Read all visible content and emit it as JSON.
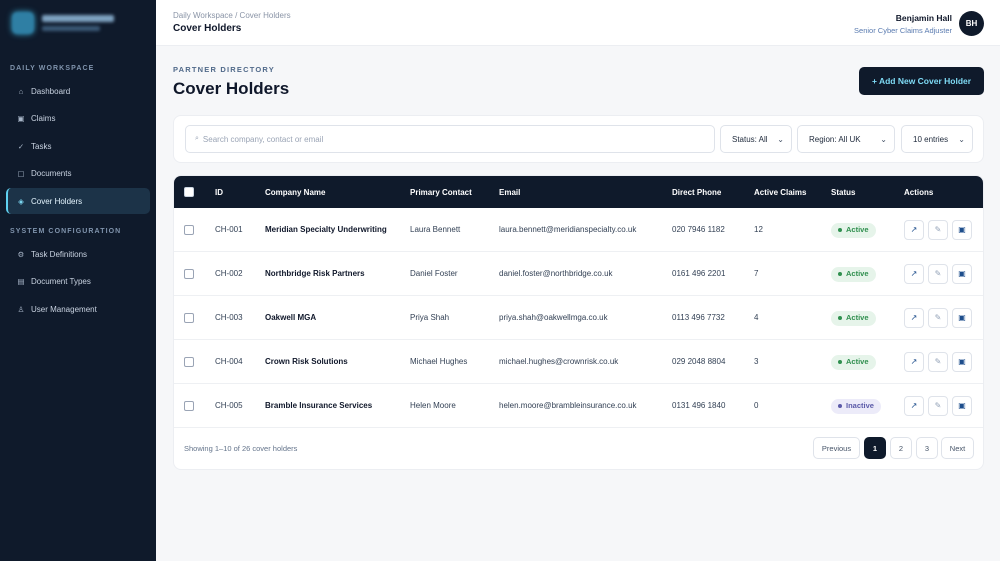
{
  "sidebar": {
    "sections": [
      {
        "title": "DAILY WORKSPACE",
        "items": [
          {
            "label": "Dashboard",
            "icon": "home-icon",
            "glyph": "⌂"
          },
          {
            "label": "Claims",
            "icon": "claims-icon",
            "glyph": "▣"
          },
          {
            "label": "Tasks",
            "icon": "check-icon",
            "glyph": "✓"
          },
          {
            "label": "Documents",
            "icon": "document-icon",
            "glyph": "▢"
          },
          {
            "label": "Cover Holders",
            "icon": "diamond-icon",
            "glyph": "◈",
            "active": true
          }
        ]
      },
      {
        "title": "SYSTEM CONFIGURATION",
        "items": [
          {
            "label": "Task Definitions",
            "icon": "gear-icon",
            "glyph": "⚙"
          },
          {
            "label": "Document Types",
            "icon": "list-icon",
            "glyph": "▤"
          },
          {
            "label": "User Management",
            "icon": "user-icon",
            "glyph": "♙"
          }
        ]
      }
    ]
  },
  "header": {
    "breadcrumb": "Daily Workspace / Cover Holders",
    "title": "Cover Holders",
    "user_name": "Benjamin Hall",
    "user_role": "Senior Cyber Claims Adjuster",
    "avatar_initials": "BH"
  },
  "page": {
    "eyebrow": "PARTNER DIRECTORY",
    "title": "Cover Holders",
    "add_button": "+ Add New Cover Holder"
  },
  "filters": {
    "search_placeholder": "Search company, contact or email",
    "status": "Status: All",
    "region": "Region: All UK",
    "entries": "10 entries"
  },
  "table": {
    "columns": [
      "ID",
      "Company Name",
      "Primary Contact",
      "Email",
      "Direct Phone",
      "Active Claims",
      "Status",
      "Actions"
    ],
    "rows": [
      {
        "id": "CH-001",
        "company": "Meridian Specialty Underwriting",
        "contact": "Laura Bennett",
        "email": "laura.bennett@meridianspecialty.co.uk",
        "phone": "020 7946 1182",
        "claims": "12",
        "status": "Active"
      },
      {
        "id": "CH-002",
        "company": "Northbridge Risk Partners",
        "contact": "Daniel Foster",
        "email": "daniel.foster@northbridge.co.uk",
        "phone": "0161 496 2201",
        "claims": "7",
        "status": "Active"
      },
      {
        "id": "CH-003",
        "company": "Oakwell MGA",
        "contact": "Priya Shah",
        "email": "priya.shah@oakwellmga.co.uk",
        "phone": "0113 496 7732",
        "claims": "4",
        "status": "Active"
      },
      {
        "id": "CH-004",
        "company": "Crown Risk Solutions",
        "contact": "Michael Hughes",
        "email": "michael.hughes@crownrisk.co.uk",
        "phone": "029 2048 8804",
        "claims": "3",
        "status": "Active"
      },
      {
        "id": "CH-005",
        "company": "Bramble Insurance Services",
        "contact": "Helen Moore",
        "email": "helen.moore@brambleinsurance.co.uk",
        "phone": "0131 496 1840",
        "claims": "0",
        "status": "Inactive"
      }
    ],
    "action_glyphs": {
      "view": "↗",
      "edit": "✎",
      "delete": "▣"
    }
  },
  "pagination": {
    "summary": "Showing 1–10 of 26 cover holders",
    "previous": "Previous",
    "pages": [
      "1",
      "2",
      "3"
    ],
    "current": "1",
    "next": "Next"
  }
}
